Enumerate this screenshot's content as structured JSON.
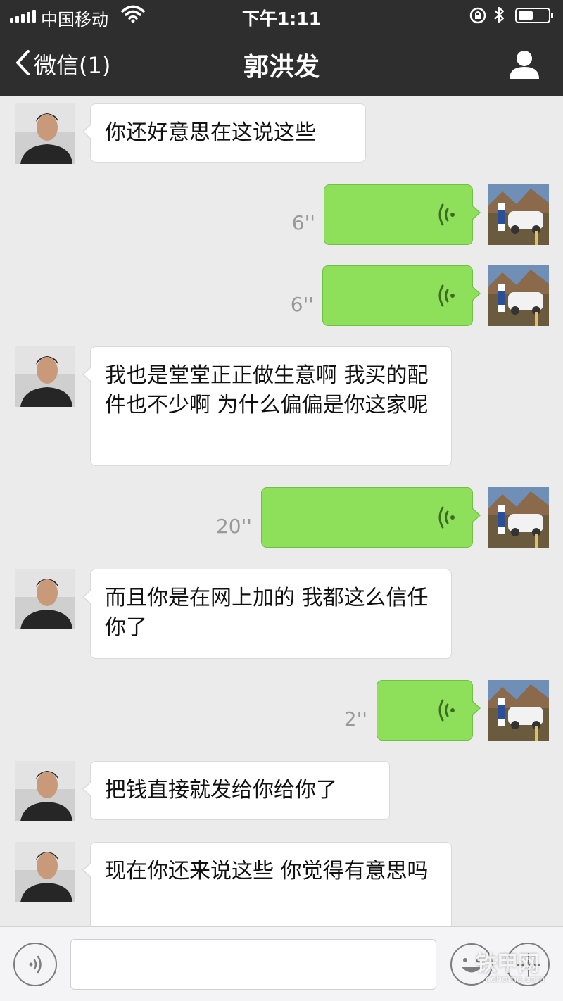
{
  "status_bar": {
    "carrier": "中国移动",
    "time": "下午1:11"
  },
  "header": {
    "back_label": "微信(1)",
    "title": "郭洪发"
  },
  "messages": [
    {
      "side": "in",
      "type": "text",
      "text": "你还好意思在这说这些"
    },
    {
      "side": "out",
      "type": "voice",
      "duration": "6''"
    },
    {
      "side": "out",
      "type": "voice",
      "duration": "6''"
    },
    {
      "side": "in",
      "type": "text",
      "text": "我也是堂堂正正做生意啊 我买的配件也不少啊 为什么偏偏是你这家呢"
    },
    {
      "side": "out",
      "type": "voice",
      "duration": "20''"
    },
    {
      "side": "in",
      "type": "text",
      "text": "而且你是在网上加的 我都这么信任你了"
    },
    {
      "side": "out",
      "type": "voice",
      "duration": "2''"
    },
    {
      "side": "in",
      "type": "text",
      "text": "把钱直接就发给你给你了"
    },
    {
      "side": "in",
      "type": "text",
      "text": "现在你还来说这些 你觉得有意思吗"
    }
  ],
  "watermark": {
    "text": "铁甲网",
    "sub": "cehome.com"
  },
  "colors": {
    "header_bg": "#2e2e2e",
    "chat_bg": "#ebebeb",
    "incoming_bubble": "#ffffff",
    "outgoing_bubble": "#8ee05a",
    "duration_text": "#999999"
  },
  "icons": {
    "back": "chevron-left-icon",
    "profile": "person-icon",
    "voice_message": "voice-wave-icon",
    "input_voice": "voice-mode-icon",
    "emoji": "emoji-icon",
    "more": "plus-icon"
  }
}
